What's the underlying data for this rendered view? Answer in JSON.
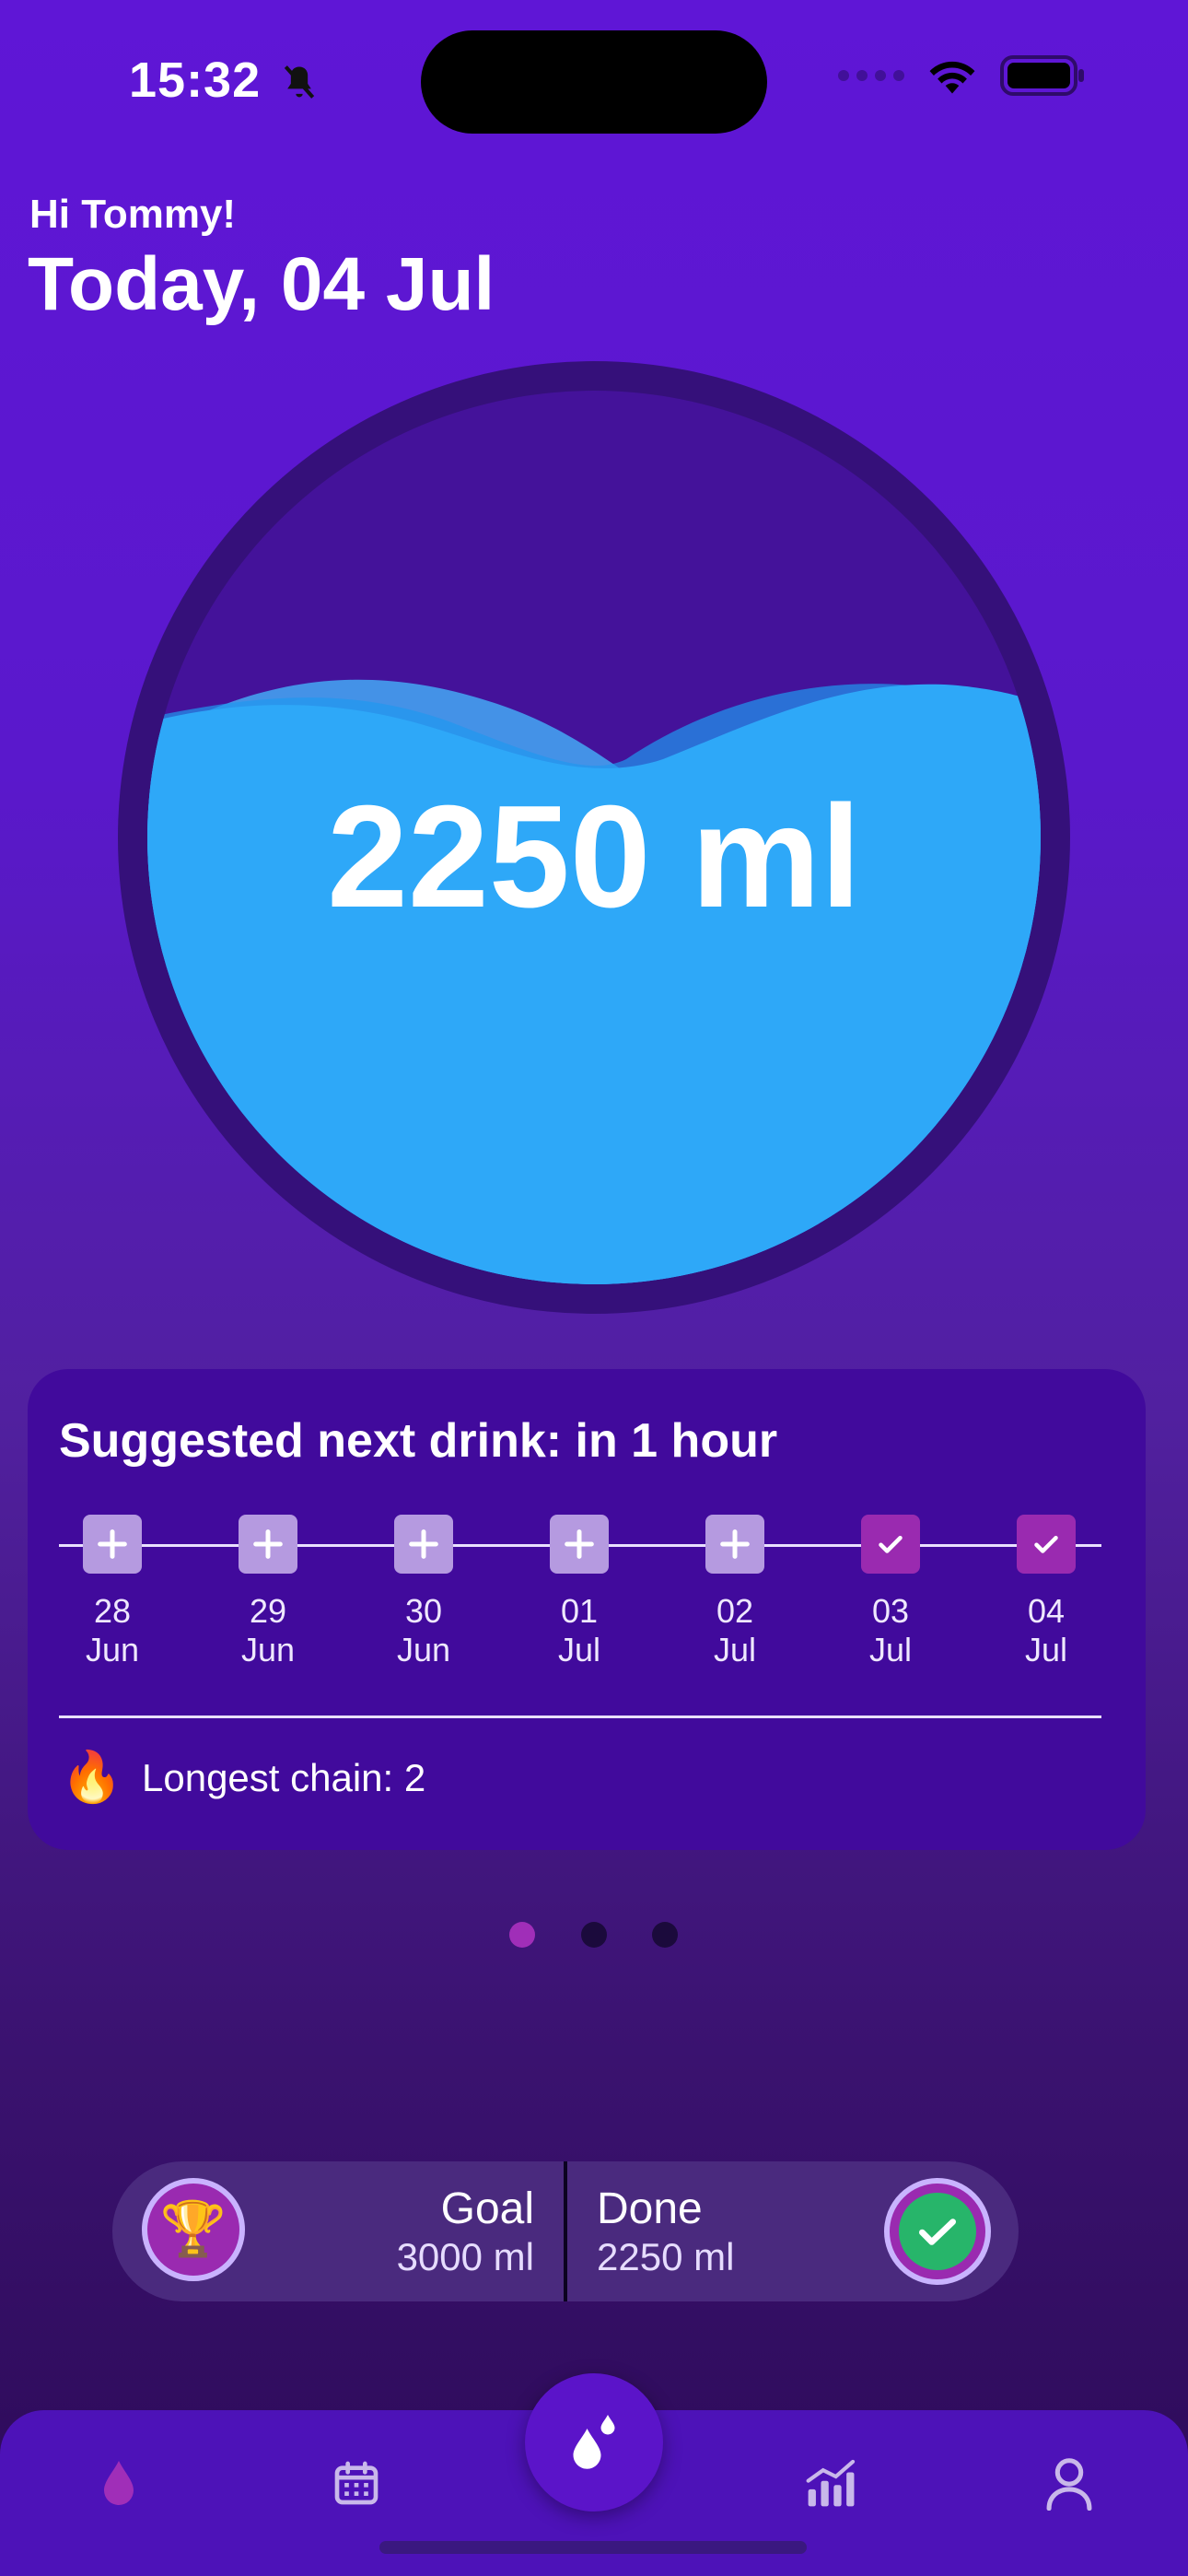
{
  "status_bar": {
    "time": "15:32"
  },
  "greeting": {
    "hi": "Hi Tommy!",
    "date": "Today, 04 Jul"
  },
  "intake": {
    "amount": "2250 ml",
    "fill_fraction": 0.75
  },
  "suggestion_card": {
    "title": "Suggested next drink: in 1 hour",
    "days": [
      {
        "day": "28",
        "month": "Jun",
        "state": "empty"
      },
      {
        "day": "29",
        "month": "Jun",
        "state": "empty"
      },
      {
        "day": "30",
        "month": "Jun",
        "state": "empty"
      },
      {
        "day": "01",
        "month": "Jul",
        "state": "empty"
      },
      {
        "day": "02",
        "month": "Jul",
        "state": "empty"
      },
      {
        "day": "03",
        "month": "Jul",
        "state": "done"
      },
      {
        "day": "04",
        "month": "Jul",
        "state": "done"
      }
    ],
    "chain_label": "Longest chain: 2"
  },
  "pager": {
    "active_index": 0,
    "count": 3
  },
  "goal": {
    "goal_label": "Goal",
    "goal_value": "3000 ml",
    "done_label": "Done",
    "done_value": "2250 ml"
  },
  "colors": {
    "water": "#2ea8f8",
    "accent": "#9a2ab0",
    "background": "#5f16d6"
  },
  "tabbar": {
    "items": [
      "water-drop-icon",
      "calendar-icon",
      "drops-icon",
      "chart-icon",
      "profile-icon"
    ]
  }
}
